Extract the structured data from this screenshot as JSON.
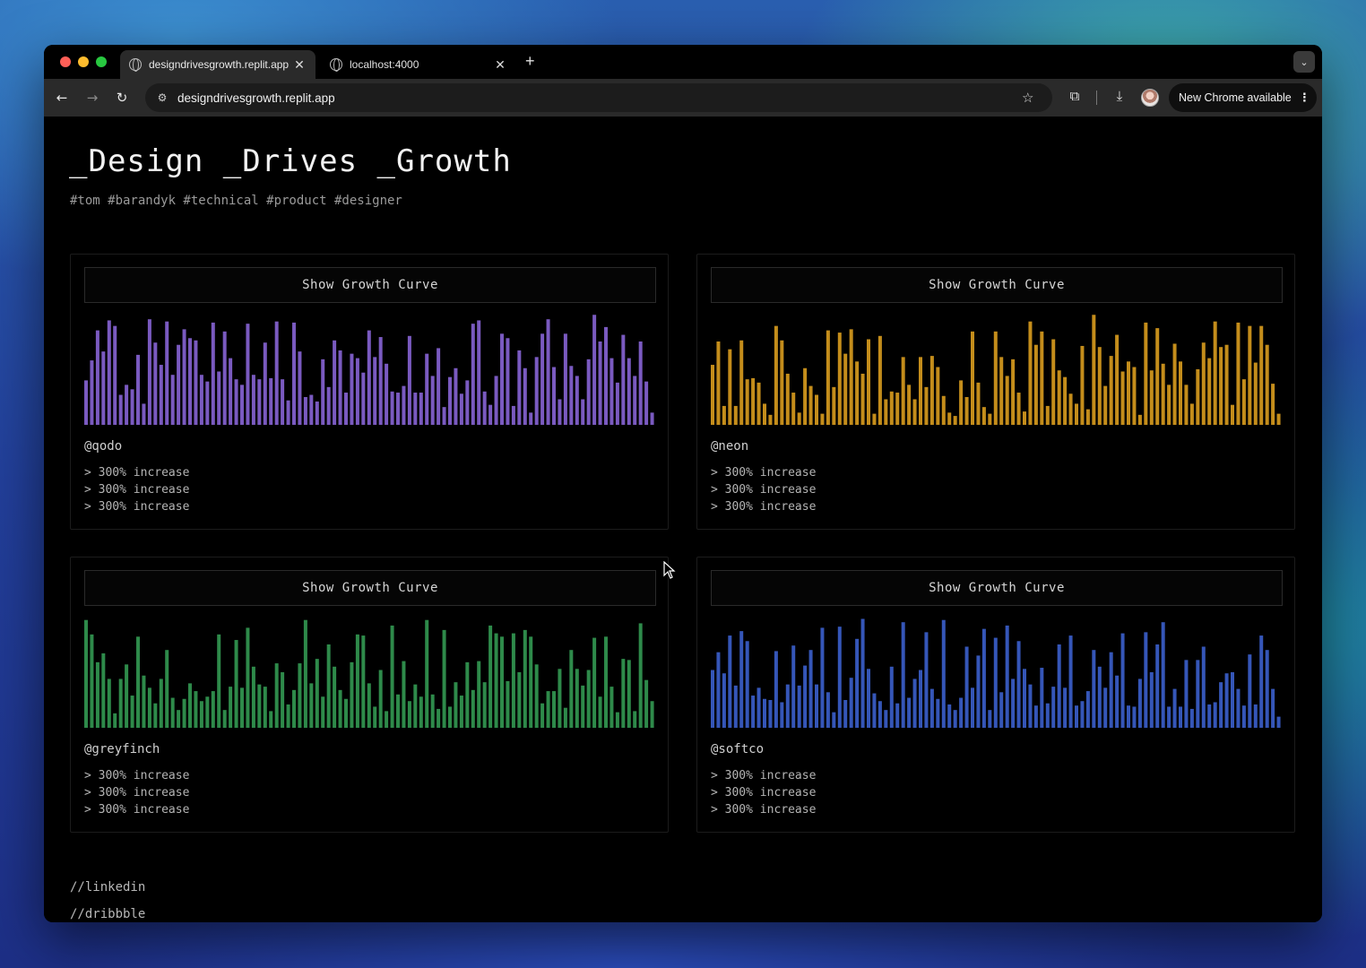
{
  "browser": {
    "tabs": [
      {
        "title": "designdrivesgrowth.replit.app",
        "active": true
      },
      {
        "title": "localhost:4000",
        "active": false
      }
    ],
    "new_tab_symbol": "+",
    "url": "designdrivesgrowth.replit.app",
    "update_button": "New Chrome available",
    "icons": {
      "back": "arrow-left-icon",
      "forward": "arrow-right-icon",
      "reload": "reload-icon",
      "site_info": "tune-icon",
      "bookmark": "star-icon",
      "extensions": "puzzle-icon",
      "downloads": "download-icon",
      "menu": "kebab-icon"
    }
  },
  "site": {
    "title": "_Design _Drives _Growth",
    "tags": "#tom #barandyk #technical #product #designer"
  },
  "cards": [
    {
      "button_label": "Show Growth Curve",
      "handle": "@qodo",
      "stats": [
        "> 300% increase",
        "> 300% increase",
        "> 300% increase"
      ]
    },
    {
      "button_label": "Show Growth Curve",
      "handle": "@neon",
      "stats": [
        "> 300% increase",
        "> 300% increase",
        "> 300% increase"
      ]
    },
    {
      "button_label": "Show Growth Curve",
      "handle": "@greyfinch",
      "stats": [
        "> 300% increase",
        "> 300% increase",
        "> 300% increase"
      ]
    },
    {
      "button_label": "Show Growth Curve",
      "handle": "@softco",
      "stats": [
        "> 300% increase",
        "> 300% increase",
        "> 300% increase"
      ]
    }
  ],
  "footer": {
    "links": [
      "//linkedin",
      "//dribbble"
    ]
  },
  "chart_data": [
    {
      "type": "bar",
      "name": "qodo",
      "color": "#7a5ac0",
      "ylim": [
        0,
        100
      ],
      "values": [
        40,
        58,
        85,
        66,
        94,
        89,
        27,
        36,
        32,
        63,
        19,
        95,
        74,
        54,
        93,
        45,
        72,
        86,
        78,
        76,
        45,
        39,
        92,
        48,
        84,
        60,
        41,
        36,
        91,
        45,
        41,
        74,
        42,
        93,
        41,
        22,
        92,
        66,
        25,
        27,
        21,
        59,
        34,
        76,
        67,
        29,
        64,
        60,
        47,
        85,
        61,
        79,
        55,
        30,
        29,
        35,
        80,
        29,
        29,
        64,
        44,
        69,
        16,
        43,
        51,
        28,
        40,
        91,
        94,
        30,
        18,
        44,
        82,
        78,
        17,
        67,
        51,
        11,
        61,
        82,
        95,
        52,
        23,
        82,
        53,
        44,
        23,
        59,
        99,
        75,
        88,
        60,
        38,
        81,
        60,
        44,
        75,
        39,
        11
      ]
    },
    {
      "type": "bar",
      "name": "neon",
      "color": "#c48d1b",
      "ylim": [
        0,
        100
      ],
      "values": [
        54,
        75,
        17,
        68,
        17,
        76,
        41,
        42,
        38,
        19,
        9,
        89,
        76,
        46,
        29,
        11,
        51,
        35,
        27,
        10,
        85,
        34,
        83,
        64,
        86,
        57,
        46,
        77,
        10,
        80,
        23,
        30,
        29,
        61,
        36,
        23,
        61,
        34,
        62,
        52,
        26,
        11,
        8,
        40,
        25,
        84,
        38,
        16,
        10,
        84,
        61,
        44,
        59,
        29,
        12,
        93,
        72,
        84,
        17,
        77,
        49,
        43,
        28,
        19,
        71,
        14,
        99,
        70,
        35,
        62,
        81,
        48,
        57,
        52,
        9,
        92,
        49,
        87,
        55,
        36,
        73,
        57,
        36,
        19,
        50,
        74,
        60,
        93,
        70,
        72,
        18,
        92,
        41,
        89,
        56,
        89,
        72,
        37,
        10
      ]
    },
    {
      "type": "bar",
      "name": "greyfinch",
      "color": "#2e8a4a",
      "ylim": [
        0,
        100
      ],
      "values": [
        97,
        84,
        59,
        67,
        44,
        13,
        44,
        57,
        29,
        82,
        47,
        36,
        22,
        44,
        70,
        27,
        16,
        26,
        40,
        33,
        24,
        28,
        33,
        84,
        16,
        37,
        79,
        36,
        90,
        55,
        39,
        37,
        15,
        58,
        50,
        21,
        34,
        58,
        97,
        40,
        62,
        28,
        75,
        55,
        34,
        26,
        59,
        84,
        83,
        40,
        19,
        52,
        15,
        92,
        30,
        60,
        24,
        39,
        28,
        97,
        30,
        17,
        88,
        19,
        41,
        29,
        59,
        34,
        60,
        41,
        92,
        85,
        82,
        42,
        85,
        50,
        88,
        82,
        57,
        22,
        33,
        33,
        53,
        18,
        70,
        53,
        38,
        52,
        81,
        28,
        82,
        37,
        14,
        62,
        61,
        15,
        94,
        43,
        24
      ]
    },
    {
      "type": "bar",
      "name": "softco",
      "color": "#3556b8",
      "ylim": [
        0,
        100
      ],
      "values": [
        52,
        68,
        49,
        83,
        38,
        87,
        78,
        29,
        36,
        26,
        25,
        69,
        23,
        39,
        74,
        38,
        56,
        70,
        39,
        90,
        32,
        14,
        91,
        25,
        45,
        80,
        98,
        53,
        31,
        24,
        16,
        55,
        22,
        95,
        27,
        44,
        52,
        86,
        35,
        26,
        97,
        21,
        16,
        27,
        73,
        36,
        65,
        89,
        16,
        81,
        32,
        92,
        44,
        78,
        53,
        39,
        20,
        54,
        22,
        37,
        75,
        36,
        83,
        20,
        24,
        33,
        70,
        55,
        36,
        68,
        47,
        85,
        20,
        19,
        44,
        86,
        50,
        75,
        95,
        19,
        35,
        19,
        61,
        17,
        61,
        73,
        21,
        23,
        41,
        49,
        50,
        35,
        20,
        66,
        21,
        83,
        70,
        35,
        10
      ]
    }
  ]
}
